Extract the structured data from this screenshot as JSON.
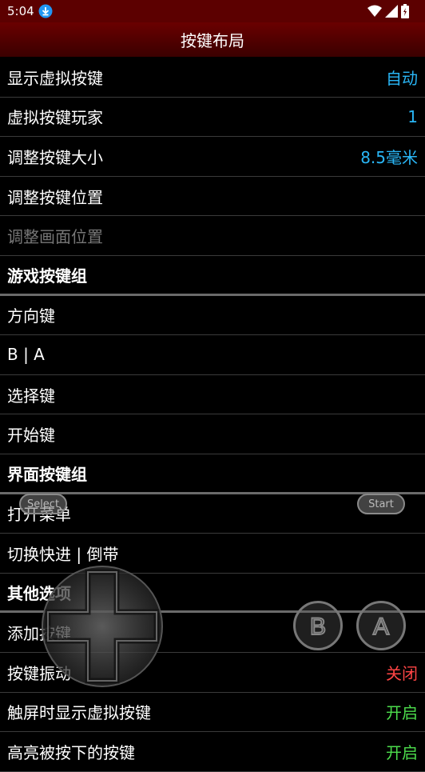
{
  "status_bar": {
    "time": "5:04"
  },
  "title": "按键布局",
  "rows": [
    {
      "label": "显示虚拟按键",
      "value": "自动",
      "value_color": "#29b6f6"
    },
    {
      "label": "虚拟按键玩家",
      "value": "1",
      "value_color": "#29b6f6"
    },
    {
      "label": "调整按键大小",
      "value": "8.5毫米",
      "value_color": "#29b6f6"
    },
    {
      "label": "调整按键位置"
    },
    {
      "label": "调整画面位置",
      "disabled": true
    },
    {
      "label": "游戏按键组",
      "header": true
    },
    {
      "label": "方向键"
    },
    {
      "label": "B | A"
    },
    {
      "label": "选择键"
    },
    {
      "label": "开始键"
    },
    {
      "label": "界面按键组",
      "header": true
    },
    {
      "label": "打开菜单"
    },
    {
      "label": "切换快进 | 倒带"
    },
    {
      "label": "其他选项",
      "header": true
    },
    {
      "label": "添加按键"
    },
    {
      "label": "按键振动",
      "value": "关闭",
      "value_color": "#ff4545"
    },
    {
      "label": "触屏时显示虚拟按键",
      "value": "开启",
      "value_color": "#4cdd4c"
    },
    {
      "label": "高亮被按下的按键",
      "value": "开启",
      "value_color": "#4cdd4c"
    }
  ],
  "gamepad": {
    "select_label": "Select",
    "start_label": "Start",
    "b_label": "B",
    "a_label": "A"
  },
  "colors": {
    "status_bg": "#5c0000",
    "title_bg": "#4a0000",
    "value_blue": "#29b6f6",
    "value_red": "#ff4545",
    "value_green": "#4cdd4c"
  }
}
